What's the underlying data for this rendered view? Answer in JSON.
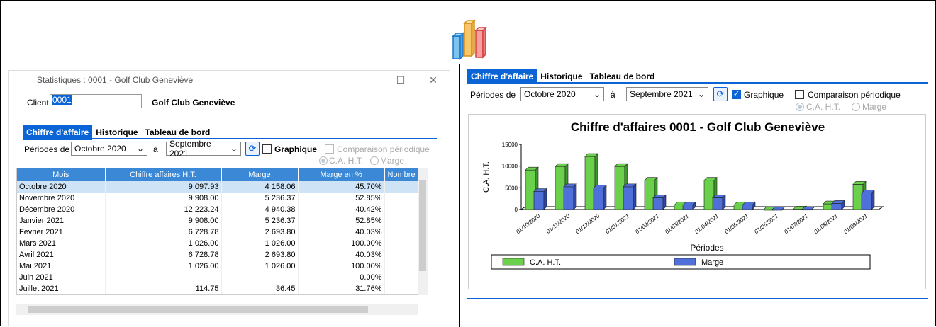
{
  "colors": {
    "accent": "#0a64d6",
    "header_blue": "#3a88d6",
    "green": "#6bd04b",
    "blue_bar": "#4f6fd9"
  },
  "window": {
    "title": "Statistiques : 0001 - Golf Club Geneviève",
    "minimize": "—",
    "maximize": "☐",
    "close": "✕"
  },
  "client": {
    "label": "Client",
    "code": "0001",
    "name": "Golf Club Geneviève"
  },
  "tabs": [
    "Chiffre d'affaire",
    "Historique",
    "Tableau de bord"
  ],
  "filters": {
    "periods_label": "Périodes de",
    "from": "Octobre 2020",
    "to_label": "à",
    "to": "Septembre 2021",
    "graph_label": "Graphique",
    "compare_label": "Comparaison périodique",
    "radio_ca": "C.A. H.T.",
    "radio_marge": "Marge"
  },
  "table": {
    "headers": [
      "Mois",
      "Chiffre affaires H.T.",
      "Marge",
      "Marge en %",
      "Nombre"
    ],
    "rows": [
      [
        "Octobre 2020",
        "9 097.93",
        "4 158.06",
        "45.70%"
      ],
      [
        "Novembre 2020",
        "9 908.00",
        "5 236.37",
        "52.85%"
      ],
      [
        "Décembre 2020",
        "12 223.24",
        "4 940.38",
        "40.42%"
      ],
      [
        "Janvier 2021",
        "9 908.00",
        "5 236.37",
        "52.85%"
      ],
      [
        "Février 2021",
        "6 728.78",
        "2 693.80",
        "40.03%"
      ],
      [
        "Mars 2021",
        "1 026.00",
        "1 026.00",
        "100.00%"
      ],
      [
        "Avril 2021",
        "6 728.78",
        "2 693.80",
        "40.03%"
      ],
      [
        "Mai 2021",
        "1 026.00",
        "1 026.00",
        "100.00%"
      ],
      [
        "Juin 2021",
        "",
        "",
        "0.00%"
      ],
      [
        "Juillet 2021",
        "114.75",
        "36.45",
        "31.76%"
      ]
    ]
  },
  "right": {
    "graph_checked": true
  },
  "chart_data": {
    "type": "bar",
    "title": "Chiffre d'affaires 0001 - Golf Club Geneviève",
    "xlabel": "Périodes",
    "ylabel": "C.A. H.T.",
    "ylim": [
      0,
      15000
    ],
    "yticks": [
      "0",
      "5000",
      "10000",
      "15000"
    ],
    "categories": [
      "01/10/2020",
      "01/11/2020",
      "01/12/2020",
      "01/01/2021",
      "01/02/2021",
      "01/03/2021",
      "01/04/2021",
      "01/05/2021",
      "01/06/2021",
      "01/07/2021",
      "01/08/2021",
      "01/09/2021"
    ],
    "series": [
      {
        "name": "C.A. H.T.",
        "values": [
          9098,
          9908,
          12223,
          9908,
          6729,
          1026,
          6729,
          1026,
          0,
          115,
          1300,
          5800
        ]
      },
      {
        "name": "Marge",
        "values": [
          4158,
          5236,
          4940,
          5236,
          2694,
          1026,
          2694,
          1026,
          0,
          36,
          1400,
          3800
        ]
      }
    ],
    "legend": "bottom"
  }
}
